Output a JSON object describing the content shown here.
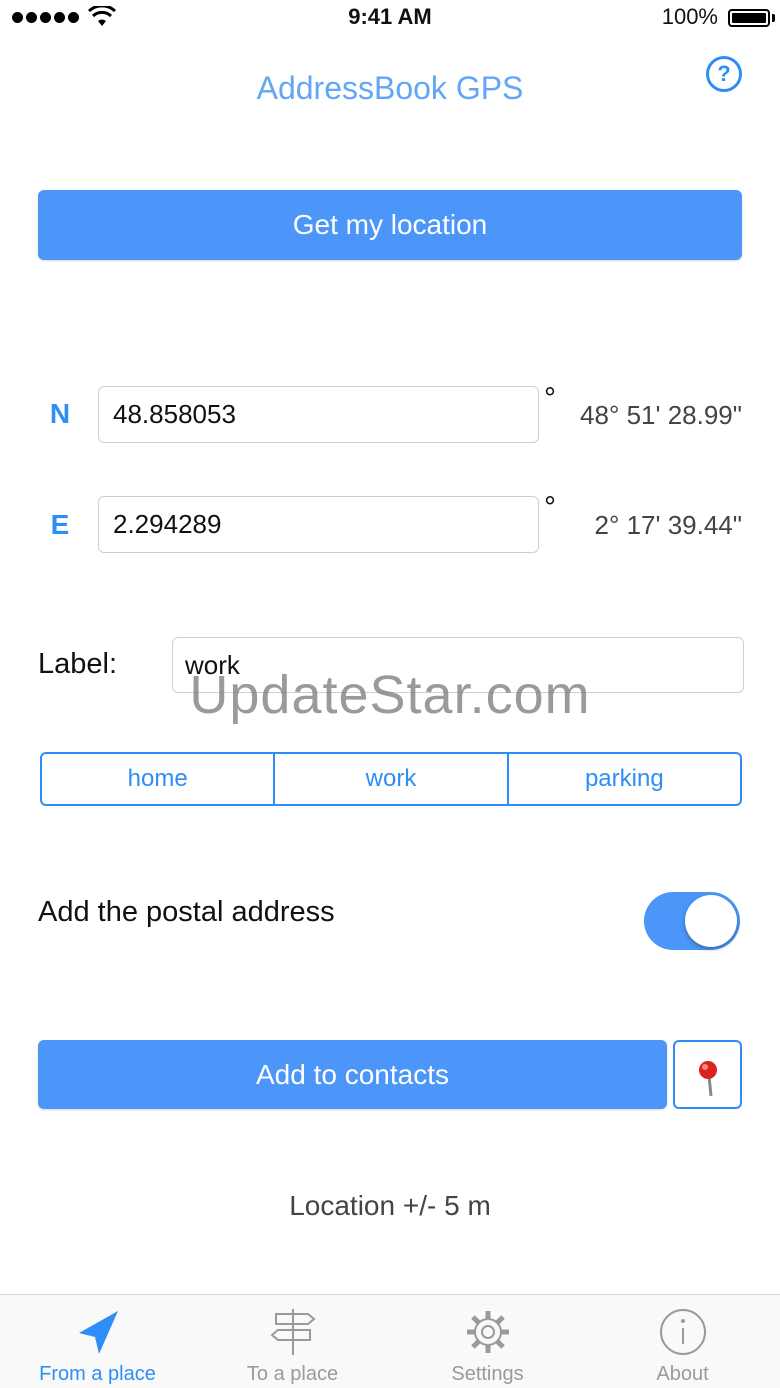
{
  "status_bar": {
    "time": "9:41 AM",
    "battery": "100%"
  },
  "header": {
    "title": "AddressBook GPS",
    "help": "?"
  },
  "actions": {
    "get_location": "Get my location",
    "add_contacts": "Add to contacts"
  },
  "coords": {
    "north": {
      "letter": "N",
      "value": "48.858053",
      "degree": "°",
      "dms": "48° 51' 28.99\""
    },
    "east": {
      "letter": "E",
      "value": "2.294289",
      "degree": "°",
      "dms": "2° 17' 39.44\""
    }
  },
  "label": {
    "caption": "Label:",
    "value": "work"
  },
  "presets": [
    "home",
    "work",
    "parking"
  ],
  "postal": {
    "caption": "Add the postal address",
    "enabled": true
  },
  "accuracy": "Location +/- 5 m",
  "watermark": "UpdateStar.com",
  "tabs": [
    {
      "label": "From a place",
      "icon": "navigation-arrow-icon",
      "active": true
    },
    {
      "label": "To a place",
      "icon": "signpost-icon",
      "active": false
    },
    {
      "label": "Settings",
      "icon": "gear-icon",
      "active": false
    },
    {
      "label": "About",
      "icon": "info-icon",
      "active": false
    }
  ],
  "colors": {
    "accent": "#2f8ef5",
    "button": "#4b96f8",
    "title": "#62a7f7"
  }
}
